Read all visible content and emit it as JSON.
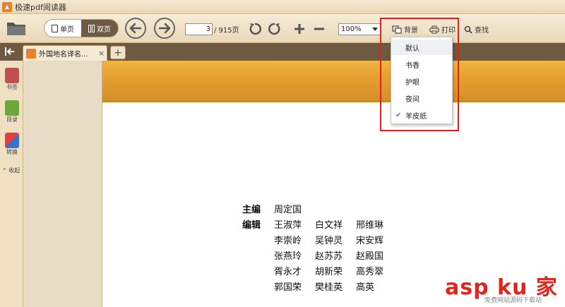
{
  "app": {
    "title": "极速pdf阅读器"
  },
  "toolbar": {
    "single_page_label": "单页",
    "double_page_label": "双页",
    "current_page": "3",
    "total_pages": "/ 915页",
    "zoom": "100%",
    "background_label": "背景",
    "print_label": "打印",
    "find_label": "查找"
  },
  "tabs": {
    "doc_title": "外国地名译名...",
    "close": "×",
    "new": "+"
  },
  "rail": {
    "bookmark": "书签",
    "toc": "目录",
    "convert": "转换",
    "collapse": "^ 收起"
  },
  "bg_menu": {
    "items": [
      "默认",
      "书香",
      "护眼",
      "夜间",
      "羊皮纸"
    ],
    "selected": "羊皮纸"
  },
  "document": {
    "credits": [
      {
        "role": "主编",
        "names": [
          "周定国",
          "",
          ""
        ]
      },
      {
        "role": "编辑",
        "names": [
          "王淑萍",
          "白文祥",
          "邢维琳"
        ]
      },
      {
        "role": "",
        "names": [
          "李崇岭",
          "吴钟灵",
          "宋安辉"
        ]
      },
      {
        "role": "",
        "names": [
          "张燕玲",
          "赵苏苏",
          "赵殿国"
        ]
      },
      {
        "role": "",
        "names": [
          "胥永才",
          "胡新荣",
          "高秀翠"
        ]
      },
      {
        "role": "",
        "names": [
          "郭国荣",
          "樊桂英",
          "高英"
        ]
      }
    ]
  },
  "watermark": {
    "main": "asp ku 家",
    "sub": "免费网站源码下载站"
  },
  "colors": {
    "accent": "#e8802c",
    "highlight_box": "#e02020",
    "check": "#3b7dd8"
  }
}
